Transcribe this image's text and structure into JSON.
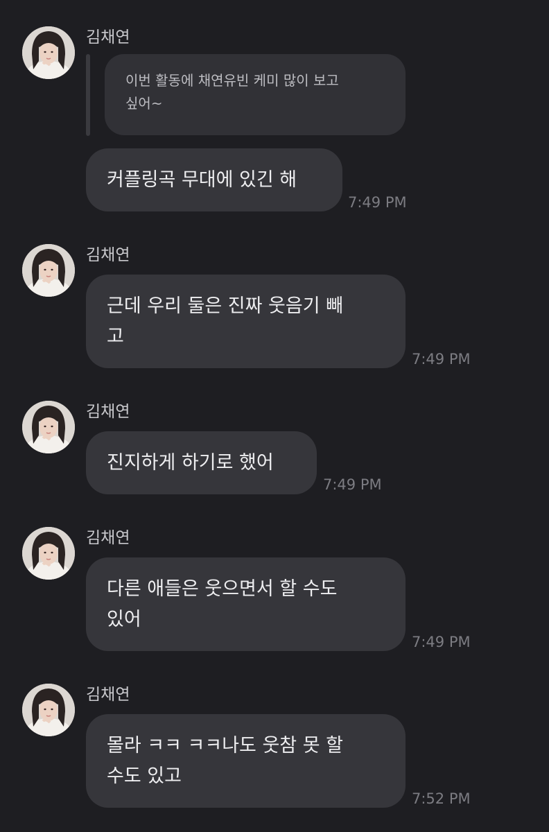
{
  "messages": [
    {
      "sender": "김채연",
      "reply_to": "이번 활동에 채연유빈 케미 많이 보고\n싶어~",
      "text": "커플링곡 무대에 있긴 해",
      "time": "7:49 PM"
    },
    {
      "sender": "김채연",
      "text": "근데 우리 둘은 진짜 웃음기 빼\n고",
      "time": "7:49 PM"
    },
    {
      "sender": "김채연",
      "text": "진지하게 하기로 했어",
      "time": "7:49 PM"
    },
    {
      "sender": "김채연",
      "text": "다른 애들은 웃으면서 할 수도\n있어",
      "time": "7:49 PM"
    },
    {
      "sender": "김채연",
      "text": "몰라 ㅋㅋ ㅋㅋ나도 웃참 못 할\n수도 있고",
      "time": "7:52 PM"
    }
  ]
}
